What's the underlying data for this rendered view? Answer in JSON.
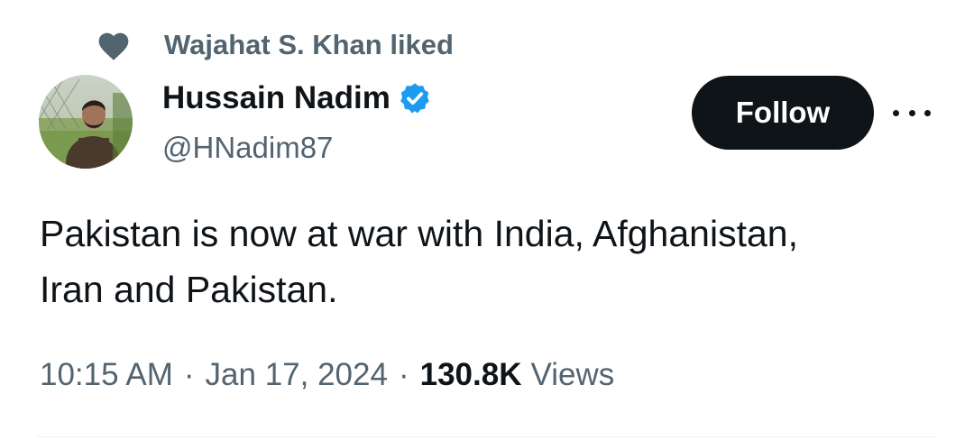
{
  "social_context": {
    "icon": "heart-icon",
    "text": "Wajahat S. Khan liked"
  },
  "author": {
    "display_name": "Hussain Nadim",
    "handle": "@HNadim87",
    "verified_icon": "verified-badge-icon",
    "verified_color": "#1d9bf0",
    "avatar_icon": "avatar"
  },
  "actions": {
    "follow_label": "Follow",
    "more_icon": "more-options-icon"
  },
  "tweet": {
    "text": "Pakistan is now at war with India, Afghanistan,\nIran and Pakistan.",
    "time": "10:15 AM",
    "date": "Jan 17, 2024",
    "separator": "·",
    "views_count": "130.8K",
    "views_label": "Views"
  },
  "colors": {
    "primary_text": "#0f1419",
    "secondary_text": "#536471",
    "follow_button_bg": "#0f1419"
  }
}
